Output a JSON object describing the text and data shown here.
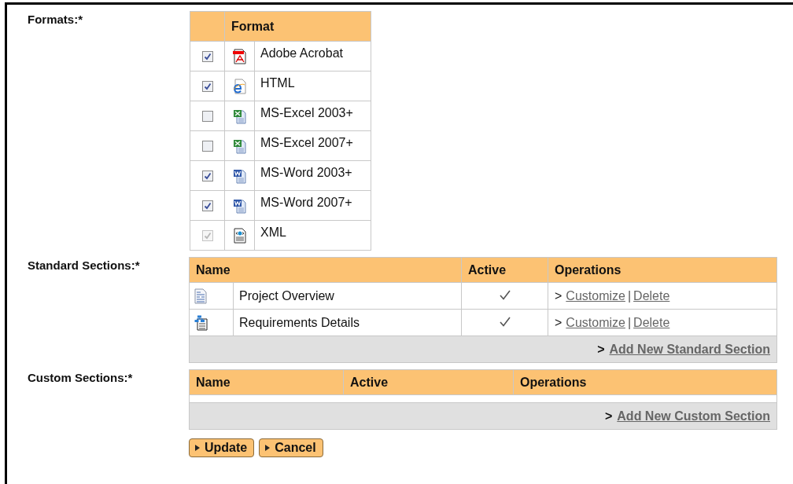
{
  "formats": {
    "label": "Formats:*",
    "column": "Format",
    "rows": [
      {
        "kind": "pdf",
        "name": "Adobe Acrobat",
        "checked": true,
        "disabled": false
      },
      {
        "kind": "html",
        "name": "HTML",
        "checked": true,
        "disabled": false
      },
      {
        "kind": "excel",
        "name": "MS-Excel 2003+",
        "checked": false,
        "disabled": false
      },
      {
        "kind": "excel",
        "name": "MS-Excel 2007+",
        "checked": false,
        "disabled": false
      },
      {
        "kind": "word",
        "name": "MS-Word 2003+",
        "checked": true,
        "disabled": false
      },
      {
        "kind": "word",
        "name": "MS-Word 2007+",
        "checked": true,
        "disabled": false
      },
      {
        "kind": "xml",
        "name": "XML",
        "checked": true,
        "disabled": true
      }
    ]
  },
  "standard_sections": {
    "label": "Standard Sections:*",
    "columns": [
      "Name",
      "Active",
      "Operations"
    ],
    "rows": [
      {
        "kind": "document",
        "name": "Project Overview",
        "active": true,
        "prefix": ">",
        "customize": "Customize",
        "separator": "|",
        "delete": "Delete"
      },
      {
        "kind": "diagram",
        "name": "Requirements Details",
        "active": true,
        "prefix": ">",
        "customize": "Customize",
        "separator": "|",
        "delete": "Delete"
      }
    ],
    "footer_prefix": ">",
    "add_link": "Add New Standard Section"
  },
  "custom_sections": {
    "label": "Custom Sections:*",
    "columns": [
      "Name",
      "Active",
      "Operations"
    ],
    "footer_prefix": ">",
    "add_link": "Add New Custom Section"
  },
  "buttons": [
    "Update",
    "Cancel"
  ]
}
